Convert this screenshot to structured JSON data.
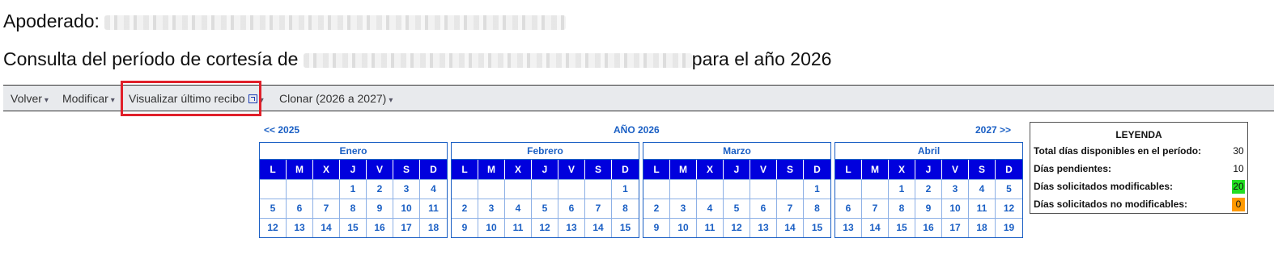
{
  "header": {
    "apoderado_label": "Apoderado:",
    "consulta_prefix": "Consulta del período de cortesía de",
    "consulta_suffix": "para el año 2026"
  },
  "toolbar": {
    "volver": "Volver",
    "modificar": "Modificar",
    "visualizar": "Visualizar último recibo",
    "clonar": "Clonar (2026 a 2027)"
  },
  "nav": {
    "prev": "<< 2025",
    "year": "AÑO 2026",
    "next": "2027 >>"
  },
  "weekdays": [
    "L",
    "M",
    "X",
    "J",
    "V",
    "S",
    "D"
  ],
  "months": [
    {
      "name": "Enero",
      "days": [
        "",
        "",
        "",
        "1",
        "2",
        "3",
        "4",
        "5",
        "6",
        "7",
        "8",
        "9",
        "10",
        "11",
        "12",
        "13",
        "14",
        "15",
        "16",
        "17",
        "18"
      ]
    },
    {
      "name": "Febrero",
      "days": [
        "",
        "",
        "",
        "",
        "",
        "",
        "1",
        "2",
        "3",
        "4",
        "5",
        "6",
        "7",
        "8",
        "9",
        "10",
        "11",
        "12",
        "13",
        "14",
        "15"
      ]
    },
    {
      "name": "Marzo",
      "days": [
        "",
        "",
        "",
        "",
        "",
        "",
        "1",
        "2",
        "3",
        "4",
        "5",
        "6",
        "7",
        "8",
        "9",
        "10",
        "11",
        "12",
        "13",
        "14",
        "15"
      ]
    },
    {
      "name": "Abril",
      "days": [
        "",
        "",
        "1",
        "2",
        "3",
        "4",
        "5",
        "6",
        "7",
        "8",
        "9",
        "10",
        "11",
        "12",
        "13",
        "14",
        "15",
        "16",
        "17",
        "18",
        "19"
      ]
    }
  ],
  "legend": {
    "title": "LEYENDA",
    "rows": [
      {
        "label": "Total días disponibles en el período:",
        "value": "30",
        "color": ""
      },
      {
        "label": "Días pendientes:",
        "value": "10",
        "color": ""
      },
      {
        "label": "Días solicitados modificables:",
        "value": "20",
        "color": "#22dd22"
      },
      {
        "label": "Días solicitados no modificables:",
        "value": "0",
        "color": "#ff9900"
      }
    ]
  }
}
